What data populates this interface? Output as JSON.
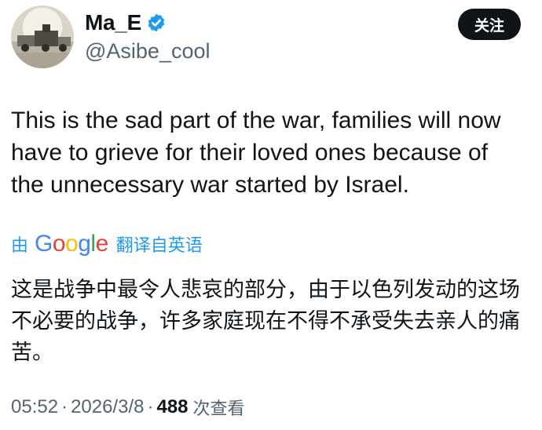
{
  "author": {
    "display_name": "Ma_E",
    "handle": "@Asibe_cool",
    "verified": true,
    "verified_color": "#1d9bf0",
    "avatar_icon": "avatar-photo"
  },
  "actions": {
    "follow_label": "关注"
  },
  "tweet": {
    "text": "This is the sad part of the war, families will now\nhave to grieve for their loved ones because of\nthe unnecessary war started by Israel."
  },
  "translation": {
    "by_label": "由",
    "provider": "Google",
    "translated_from_label": "翻译自英语",
    "text": "这是战争中最令人悲哀的部分，由于以色列发动的这场不必要的战争，许多家庭现在不得不承受失去亲人的痛苦。",
    "link_color": "#1d9bf0"
  },
  "meta": {
    "time": "05:52",
    "separator": "·",
    "date": "2026/3/8",
    "views_count": "488",
    "views_label": "次查看"
  }
}
